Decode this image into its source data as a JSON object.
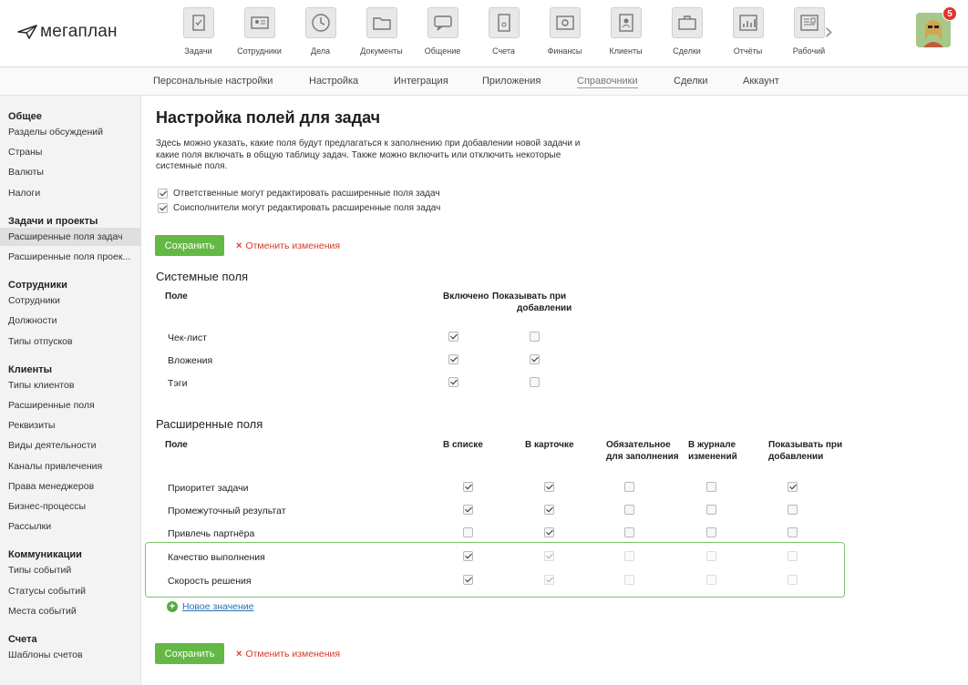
{
  "logo": {
    "text": "мегаплан"
  },
  "apps": [
    {
      "label": "Задачи",
      "icon": "tasks-icon"
    },
    {
      "label": "Сотрудники",
      "icon": "employees-icon"
    },
    {
      "label": "Дела",
      "icon": "clock-icon"
    },
    {
      "label": "Документы",
      "icon": "folder-icon"
    },
    {
      "label": "Общение",
      "icon": "chat-icon"
    },
    {
      "label": "Счета",
      "icon": "invoice-icon"
    },
    {
      "label": "Финансы",
      "icon": "safe-icon"
    },
    {
      "label": "Клиенты",
      "icon": "contacts-icon"
    },
    {
      "label": "Сделки",
      "icon": "briefcase-icon"
    },
    {
      "label": "Отчёты",
      "icon": "chart-icon"
    },
    {
      "label": "Рабочий",
      "icon": "dashboard-icon"
    }
  ],
  "notifications": {
    "count": "5"
  },
  "subnav": {
    "items": [
      "Персональные настройки",
      "Настройка",
      "Интеграция",
      "Приложения",
      "Справочники",
      "Сделки",
      "Аккаунт"
    ],
    "active": "Справочники"
  },
  "sidebar": {
    "groups": [
      {
        "title": "Общее",
        "items": [
          "Разделы обсуждений",
          "Страны",
          "Валюты",
          "Налоги"
        ]
      },
      {
        "title": "Задачи и проекты",
        "items": [
          "Расширенные поля задач",
          "Расширенные поля проек..."
        ]
      },
      {
        "title": "Сотрудники",
        "items": [
          "Сотрудники",
          "Должности",
          "Типы отпусков"
        ]
      },
      {
        "title": "Клиенты",
        "items": [
          "Типы клиентов",
          "Расширенные поля",
          "Реквизиты",
          "Виды деятельности",
          "Каналы привлечения",
          "Права менеджеров",
          "Бизнес-процессы",
          "Рассылки"
        ]
      },
      {
        "title": "Коммуникации",
        "items": [
          "Типы событий",
          "Статусы событий",
          "Места событий"
        ]
      },
      {
        "title": "Счета",
        "items": [
          "Шаблоны счетов"
        ]
      }
    ],
    "active_item": "Расширенные поля задач"
  },
  "main": {
    "title": "Настройка полей для задач",
    "description": "Здесь можно указать, какие поля будут предлагаться к заполнению при добавлении новой задачи и какие поля включать в общую таблицу задач. Также можно включить или отключить некоторые системные поля.",
    "options": [
      {
        "label": "Ответственные могут редактировать расширенные поля задач",
        "checked": true
      },
      {
        "label": "Соисполнители могут редактировать расширенные поля задач",
        "checked": true
      }
    ],
    "save_label": "Сохранить",
    "cancel_label": "Отменить изменения",
    "system_fields": {
      "title": "Системные поля",
      "headers": {
        "field": "Поле",
        "enabled": "Включено",
        "show_on_add_1": "Показывать при",
        "show_on_add_2": "добавлении"
      },
      "rows": [
        {
          "name": "Чек-лист",
          "enabled": true,
          "show_on_add": false
        },
        {
          "name": "Вложения",
          "enabled": true,
          "show_on_add": true
        },
        {
          "name": "Тэги",
          "enabled": true,
          "show_on_add": false
        }
      ]
    },
    "extended_fields": {
      "title": "Расширенные поля",
      "headers": {
        "field": "Поле",
        "in_list": "В списке",
        "in_card": "В карточке",
        "required_1": "Обязательное",
        "required_2": "для заполнения",
        "log_1": "В журнале",
        "log_2": "изменений",
        "show_1": "Показывать при",
        "show_2": "добавлении"
      },
      "rows": [
        {
          "name": "Приоритет задачи",
          "values": [
            true,
            true,
            false,
            false,
            true
          ],
          "disabled": [
            false,
            false,
            false,
            false,
            false
          ]
        },
        {
          "name": "Промежуточный результат",
          "values": [
            true,
            true,
            false,
            false,
            false
          ],
          "disabled": [
            false,
            false,
            false,
            false,
            false
          ]
        },
        {
          "name": "Привлечь партнёра",
          "values": [
            false,
            true,
            false,
            false,
            false
          ],
          "disabled": [
            false,
            false,
            false,
            false,
            false
          ]
        },
        {
          "name": "Качество выполнения",
          "values": [
            true,
            true,
            false,
            false,
            false
          ],
          "disabled": [
            false,
            true,
            true,
            true,
            true
          ]
        },
        {
          "name": "Скорость решения",
          "values": [
            true,
            true,
            false,
            false,
            false
          ],
          "disabled": [
            false,
            true,
            true,
            true,
            true
          ]
        }
      ],
      "add_new_label": "Новое значение"
    }
  }
}
